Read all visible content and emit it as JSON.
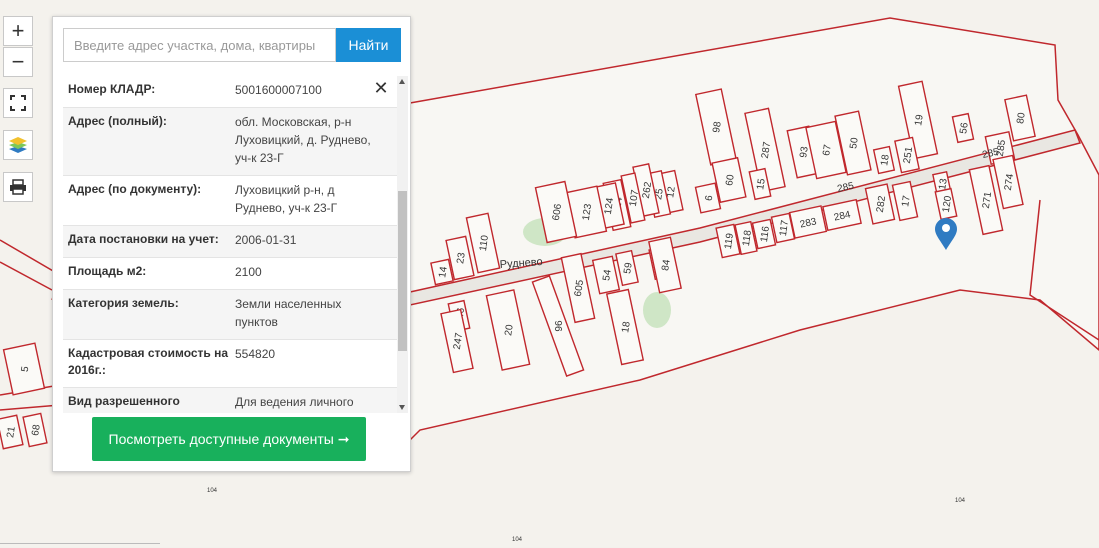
{
  "controls": {
    "zoom_in": "+",
    "zoom_out": "−",
    "fullscreen_icon": "fullscreen-icon",
    "layers_icon": "layers-icon",
    "print_icon": "print-icon"
  },
  "search": {
    "placeholder": "Введите адрес участка, дома, квартиры",
    "button": "Найти"
  },
  "info": [
    {
      "key": "Номер КЛАДР:",
      "value": "5001600007100"
    },
    {
      "key": "Адрес (полный):",
      "value": "обл. Московская, р-н Луховицкий, д. Руднево, уч-к 23-Г"
    },
    {
      "key": "Адрес (по документу):",
      "value": "Луховицкий р-н, д Руднево, уч-к 23-Г"
    },
    {
      "key": "Дата постановки на учет:",
      "value": "2006-01-31"
    },
    {
      "key": "Площадь м2:",
      "value": "2100"
    },
    {
      "key": "Категория земель:",
      "value": "Земли населенных пунктов"
    },
    {
      "key": "Кадастровая стоимость на 2016г.:",
      "value": "554820"
    },
    {
      "key": "Вид разрешенного использования (по документам):",
      "value": "Для ведения личного подсобного хозяйства"
    }
  ],
  "docs_button": "Посмотреть доступные документы ➞",
  "map": {
    "village_label": "Руднево",
    "road_label": "285",
    "parcel_labels": [
      "98",
      "287",
      "93",
      "67",
      "50",
      "19",
      "56",
      "80",
      "18",
      "251",
      "285",
      "274",
      "271",
      "13",
      "120",
      "60",
      "15",
      "6",
      "282",
      "17",
      "284",
      "283",
      "117",
      "116",
      "118",
      "119",
      "12",
      "25",
      "262",
      "107",
      "114",
      "124",
      "123",
      "606",
      "110",
      "14",
      "23",
      "19",
      "84",
      "59",
      "54",
      "605",
      "96",
      "18",
      "20",
      "246",
      "247",
      "5",
      "68",
      "21"
    ],
    "boundary_marks": [
      "104",
      "104",
      "104"
    ],
    "colors": {
      "parcel": "#c0282d",
      "marker": "#2f7bc2"
    }
  }
}
